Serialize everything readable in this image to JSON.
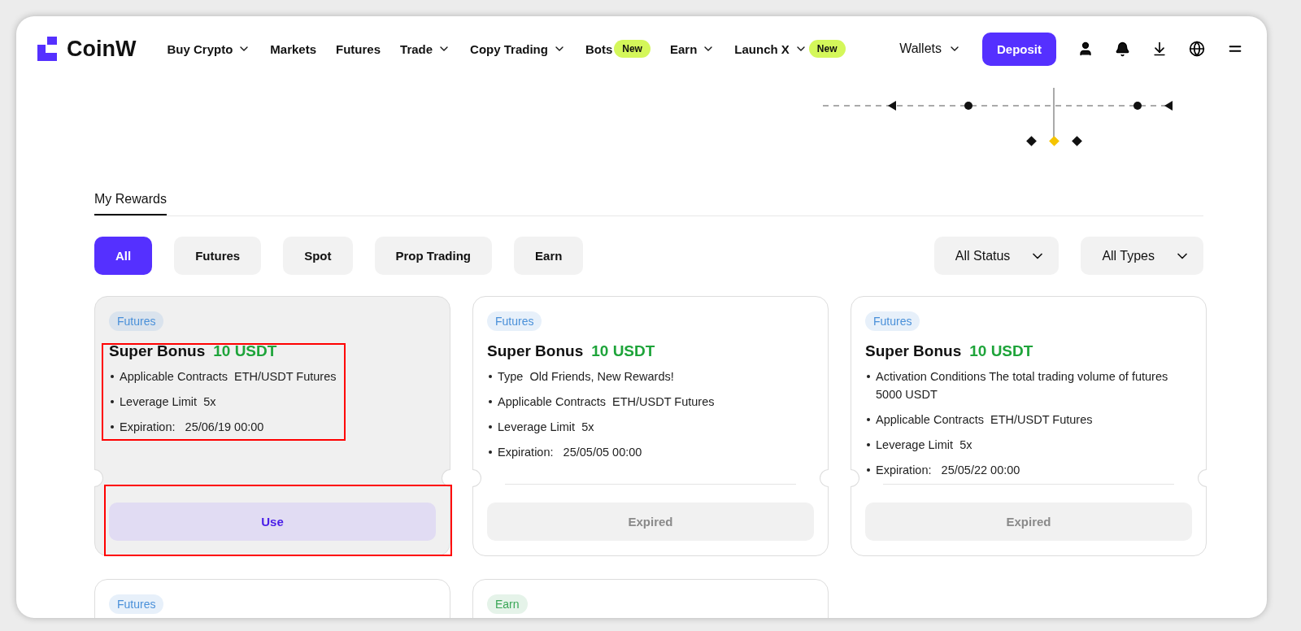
{
  "nav": {
    "brand": "CoinW",
    "items": [
      {
        "label": "Buy Crypto",
        "dropdown": true
      },
      {
        "label": "Markets",
        "dropdown": false
      },
      {
        "label": "Futures",
        "dropdown": false
      },
      {
        "label": "Trade",
        "dropdown": true
      },
      {
        "label": "Copy Trading",
        "dropdown": true
      },
      {
        "label": "Bots",
        "dropdown": false,
        "badge": "New"
      },
      {
        "label": "Earn",
        "dropdown": true
      },
      {
        "label": "Launch X",
        "dropdown": true,
        "badge": "New"
      }
    ],
    "wallets": "Wallets",
    "deposit": "Deposit"
  },
  "section_tabs": [
    {
      "label": "My Rewards",
      "selected": true
    }
  ],
  "filters": [
    {
      "label": "All",
      "selected": true
    },
    {
      "label": "Futures",
      "selected": false
    },
    {
      "label": "Spot",
      "selected": false
    },
    {
      "label": "Prop Trading",
      "selected": false
    },
    {
      "label": "Earn",
      "selected": false
    }
  ],
  "dropdowns": [
    "All Status",
    "All Types"
  ],
  "cards": [
    {
      "tag": "Futures",
      "color": "#4a90d9",
      "highlighted": true,
      "title": "Super Bonus",
      "amount": "10 USDT",
      "details": [
        "Applicable Contracts  ETH/USDT Futures",
        "Leverage Limit  5x",
        "Expiration:   25/06/19 00:00"
      ],
      "action": {
        "kind": "use",
        "label": "Use"
      }
    },
    {
      "tag": "Futures",
      "color": "#4a90d9",
      "highlighted": false,
      "title": "Super Bonus",
      "amount": "10 USDT",
      "details": [
        "Type  Old Friends, New Rewards!",
        "Applicable Contracts  ETH/USDT Futures",
        "Leverage Limit  5x",
        "Expiration:   25/05/05 00:00"
      ],
      "action": {
        "kind": "expired",
        "label": "Expired"
      }
    },
    {
      "tag": "Futures",
      "color": "#4a90d9",
      "highlighted": false,
      "title": "Super Bonus",
      "amount": "10 USDT",
      "details": [
        "Activation Conditions The total trading volume of futures  5000 USDT",
        "Applicable Contracts  ETH/USDT Futures",
        "Leverage Limit  5x",
        "Expiration:   25/05/22 00:00"
      ],
      "action": {
        "kind": "expired",
        "label": "Expired"
      }
    },
    {
      "tag": "Futures",
      "color": "#4a90d9",
      "highlighted": false
    },
    {
      "tag": "Earn",
      "color": "#3aa757",
      "highlighted": false
    }
  ]
}
